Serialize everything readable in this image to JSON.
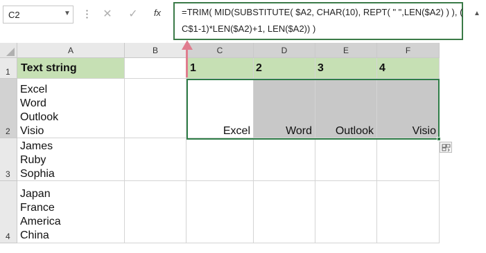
{
  "name_box": "C2",
  "formula": {
    "line1": "=TRIM( MID(SUBSTITUTE( $A2, CHAR(10), REPT( \" \",LEN($A2) ) ), (",
    "line2": "C$1-1)*LEN($A2)+1, LEN($A2)) )",
    "cancel_glyph": "✕",
    "enter_glyph": "✓",
    "fx_label": "fx"
  },
  "columns": [
    "A",
    "B",
    "C",
    "D",
    "E",
    "F"
  ],
  "rows": [
    "1",
    "2",
    "3",
    "4"
  ],
  "cells": {
    "A1": "Text string",
    "C1": "1",
    "D1": "2",
    "E1": "3",
    "F1": "4",
    "A2": [
      "Excel",
      "Word",
      "Outlook",
      "Visio"
    ],
    "A3": [
      "James",
      "Ruby",
      "Sophia"
    ],
    "A4": [
      "Japan",
      "France",
      "America",
      "China"
    ],
    "C2": "Excel",
    "D2": "Word",
    "E2": "Outlook",
    "F2": "Visio"
  },
  "colors": {
    "header_fill": "#c6e0b4",
    "result_fill": "#c8c8c8",
    "selection": "#2e7d47",
    "arrow": "#e07c8e"
  }
}
